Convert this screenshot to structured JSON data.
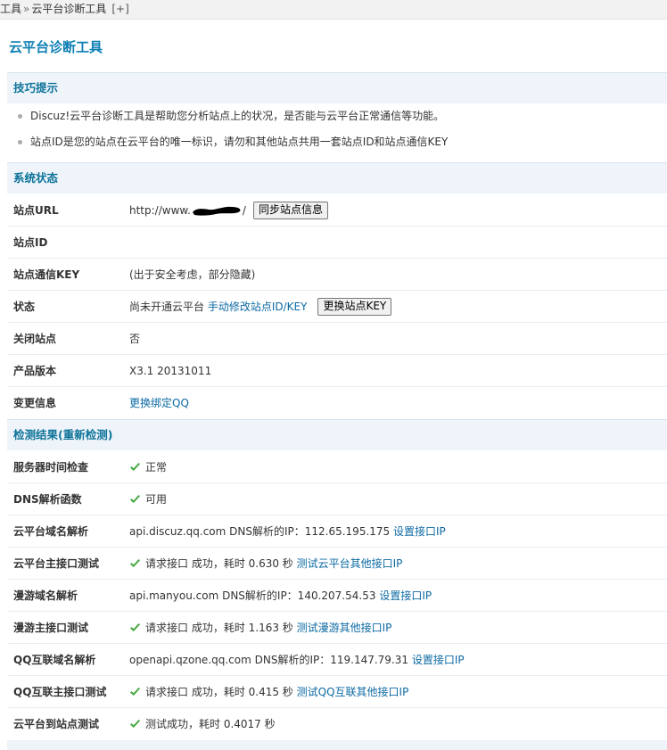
{
  "breadcrumb": {
    "first": "工具",
    "separator": "»",
    "current": "云平台诊断工具",
    "toggle": "[+]"
  },
  "page_title": "云平台诊断工具",
  "tips": {
    "title": "技巧提示",
    "items": [
      "Discuz!云平台诊断工具是帮助您分析站点上的状况，是否能与云平台正常通信等功能。",
      "站点ID是您的站点在云平台的唯一标识，请勿和其他站点共用一套站点ID和站点通信KEY"
    ]
  },
  "system": {
    "title": "系统状态",
    "site_url": {
      "label": "站点URL",
      "value": "http://www.",
      "tail": "/",
      "button": "同步站点信息"
    },
    "site_id": {
      "label": "站点ID",
      "value": ""
    },
    "site_key": {
      "label": "站点通信KEY",
      "value": "(出于安全考虑，部分隐藏)"
    },
    "status": {
      "label": "状态",
      "value": "尚未开通云平台",
      "link": "手动修改站点ID/KEY",
      "button": "更换站点KEY"
    },
    "closed": {
      "label": "关闭站点",
      "value": "否"
    },
    "version": {
      "label": "产品版本",
      "value": "X3.1 20131011"
    },
    "change": {
      "label": "变更信息",
      "link": "更换绑定QQ"
    }
  },
  "results": {
    "title": "检测结果(重新检测)",
    "server_time": {
      "label": "服务器时间检查",
      "value": "正常"
    },
    "dns_func": {
      "label": "DNS解析函数",
      "value": "可用"
    },
    "cloud_dns": {
      "label": "云平台域名解析",
      "value": "api.discuz.qq.com DNS解析的IP：112.65.195.175",
      "link": "设置接口IP"
    },
    "cloud_api": {
      "label": "云平台主接口测试",
      "value": "请求接口 成功，耗时 0.630 秒",
      "link": "测试云平台其他接口IP"
    },
    "manyou_dns": {
      "label": "漫游域名解析",
      "value": "api.manyou.com DNS解析的IP：140.207.54.53",
      "link": "设置接口IP"
    },
    "manyou_api": {
      "label": "漫游主接口测试",
      "value": "请求接口 成功，耗时 1.163 秒",
      "link": "测试漫游其他接口IP"
    },
    "qq_dns": {
      "label": "QQ互联域名解析",
      "value": "openapi.qzone.qq.com DNS解析的IP：119.147.79.31",
      "link": "设置接口IP"
    },
    "qq_api": {
      "label": "QQ互联主接口测试",
      "value": "请求接口 成功，耗时 0.415 秒",
      "link": "测试QQ互联其他接口IP"
    },
    "cloud_site": {
      "label": "云平台到站点测试",
      "value": "测试成功，耗时 0.4017 秒"
    }
  },
  "colors": {
    "accent": "#0d7fb4",
    "link": "#0d6aa3",
    "section_bg": "#eef4fa",
    "check": "#3fa63a"
  },
  "icons": {
    "check": "check-icon",
    "bullet": "bullet-icon"
  }
}
